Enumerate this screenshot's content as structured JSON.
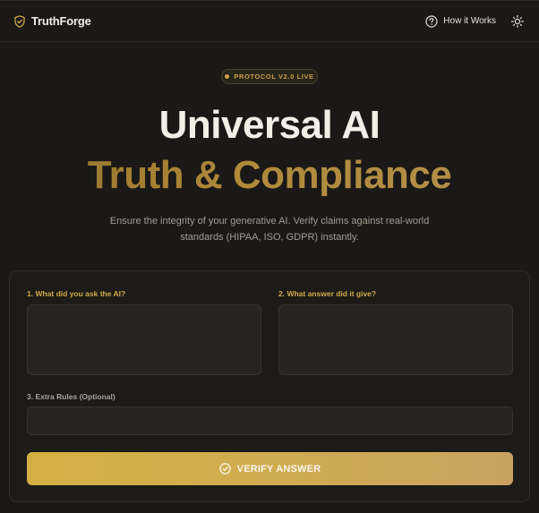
{
  "header": {
    "brand_name": "TruthForge",
    "brand_icon": "shield-check-icon",
    "how_it_works_label": "How it Works",
    "how_it_works_icon": "help-circle-icon",
    "theme_toggle_icon": "sun-icon"
  },
  "badge": {
    "text": "PROTOCOL V2.0 LIVE",
    "dot_color": "#c9a047"
  },
  "hero": {
    "title_line1": "Universal AI",
    "title_line2": "Truth & Compliance",
    "subtitle": "Ensure the integrity of your generative AI. Verify claims against real-world standards (HIPAA, ISO, GDPR) instantly."
  },
  "form": {
    "question": {
      "label": "1. What did you ask the AI?",
      "value": "",
      "placeholder": ""
    },
    "answer": {
      "label": "2. What answer did it give?",
      "value": "",
      "placeholder": ""
    },
    "extra_rules": {
      "label": "3. Extra Rules (Optional)",
      "value": "",
      "placeholder": ""
    },
    "verify_button": {
      "label": "VERIFY ANSWER",
      "icon": "check-circle-icon"
    }
  },
  "colors": {
    "background": "#1a1917",
    "accent_gold": "#d2a94a",
    "button_gradient_start": "#d4b043",
    "button_gradient_end": "#c9a260"
  }
}
